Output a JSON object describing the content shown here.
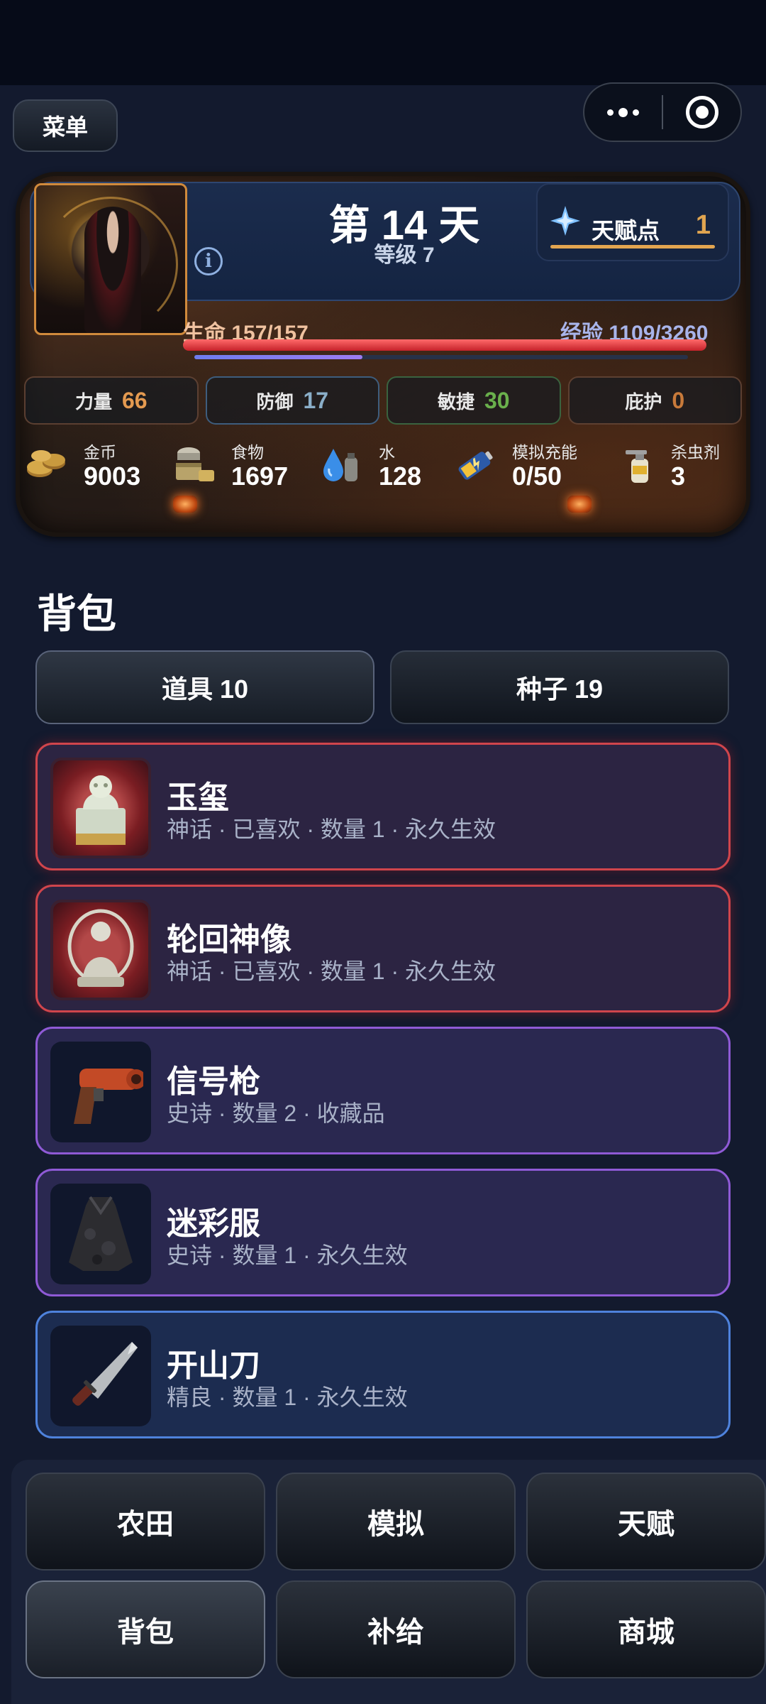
{
  "header": {
    "menu_label": "菜单"
  },
  "status": {
    "day_title": "第 14 天",
    "level": "等级 7",
    "talent_label": "天赋点",
    "talent_value": "1",
    "hp_text": "生命 157/157",
    "xp_text": "经验 1109/3260",
    "hp_fraction": 1.0,
    "xp_fraction": 0.34
  },
  "stats": [
    {
      "name": "力量",
      "value": "66",
      "color": "#e49a50"
    },
    {
      "name": "防御",
      "value": "17",
      "color": "#8aaec8"
    },
    {
      "name": "敏捷",
      "value": "30",
      "color": "#6ab04c"
    },
    {
      "name": "庇护",
      "value": "0",
      "color": "#c87a3a"
    }
  ],
  "resources": [
    {
      "name": "金币",
      "value": "9003",
      "icon": "coins-icon"
    },
    {
      "name": "食物",
      "value": "1697",
      "icon": "food-icon"
    },
    {
      "name": "水",
      "value": "128",
      "icon": "water-icon"
    },
    {
      "name": "模拟充能",
      "value": "0/50",
      "icon": "battery-icon"
    },
    {
      "name": "杀虫剂",
      "value": "3",
      "icon": "spray-icon"
    }
  ],
  "inventory": {
    "title": "背包",
    "tabs": [
      {
        "label": "道具 10",
        "active": true
      },
      {
        "label": "种子 19",
        "active": false
      }
    ],
    "items": [
      {
        "name": "玉玺",
        "meta": "神话 · 已喜欢 · 数量 1 · 永久生效",
        "rarity": "myth",
        "icon": "jade-seal-icon"
      },
      {
        "name": "轮回神像",
        "meta": "神话 · 已喜欢 · 数量 1 · 永久生效",
        "rarity": "myth",
        "icon": "deity-statue-icon"
      },
      {
        "name": "信号枪",
        "meta": "史诗 · 数量 2 · 收藏品",
        "rarity": "epic",
        "icon": "flare-gun-icon"
      },
      {
        "name": "迷彩服",
        "meta": "史诗 · 数量 1 · 永久生效",
        "rarity": "epic",
        "icon": "camo-cloak-icon"
      },
      {
        "name": "开山刀",
        "meta": "精良 · 数量 1 · 永久生效",
        "rarity": "fine",
        "icon": "machete-icon"
      }
    ]
  },
  "nav": [
    {
      "label": "农田",
      "active": false
    },
    {
      "label": "模拟",
      "active": false
    },
    {
      "label": "天赋",
      "active": false
    },
    {
      "label": "背包",
      "active": true
    },
    {
      "label": "补给",
      "active": false
    },
    {
      "label": "商城",
      "active": false
    }
  ]
}
